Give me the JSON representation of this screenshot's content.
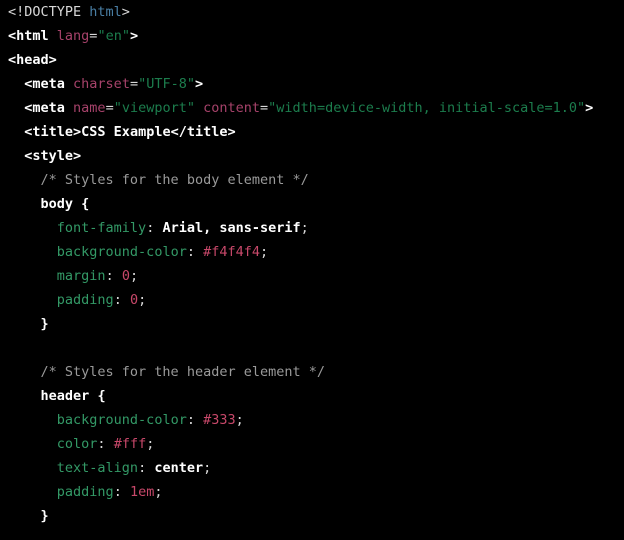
{
  "editor": {
    "background_color": "#000000",
    "language": "html",
    "font_size_px": 13.5,
    "line_height_px": 24,
    "tab_size": 2
  },
  "theme": {
    "punctuation": "#d8d8d8",
    "doctype": "#d8d8d8",
    "doctype_name": "#4a7fa5",
    "tag": "#ffffff",
    "attribute": "#a6426a",
    "string": "#1c7d4d",
    "text": "#ffffff",
    "comment": "#9a9a9a",
    "selector": "#ffffff",
    "property": "#339966",
    "value": "#ffffff",
    "number": "#c8486a"
  },
  "lines": [
    {
      "n": 1,
      "indent": "",
      "tokens": [
        {
          "t": "<!DOCTYPE ",
          "c": "t-doctype"
        },
        {
          "t": "html",
          "c": "t-doctype-name"
        },
        {
          "t": ">",
          "c": "t-punct"
        }
      ]
    },
    {
      "n": 2,
      "indent": "",
      "tokens": [
        {
          "t": "<html",
          "c": "t-tag"
        },
        {
          "t": " ",
          "c": "t-punct"
        },
        {
          "t": "lang",
          "c": "t-attr"
        },
        {
          "t": "=",
          "c": "t-punct"
        },
        {
          "t": "\"en\"",
          "c": "t-string"
        },
        {
          "t": ">",
          "c": "t-tag"
        }
      ]
    },
    {
      "n": 3,
      "indent": "",
      "tokens": [
        {
          "t": "<head>",
          "c": "t-tag"
        }
      ]
    },
    {
      "n": 4,
      "indent": "  ",
      "tokens": [
        {
          "t": "<meta",
          "c": "t-tag"
        },
        {
          "t": " ",
          "c": "t-punct"
        },
        {
          "t": "charset",
          "c": "t-attr"
        },
        {
          "t": "=",
          "c": "t-punct"
        },
        {
          "t": "\"UTF-8\"",
          "c": "t-string"
        },
        {
          "t": ">",
          "c": "t-tag"
        }
      ]
    },
    {
      "n": 5,
      "indent": "  ",
      "tokens": [
        {
          "t": "<meta",
          "c": "t-tag"
        },
        {
          "t": " ",
          "c": "t-punct"
        },
        {
          "t": "name",
          "c": "t-attr"
        },
        {
          "t": "=",
          "c": "t-punct"
        },
        {
          "t": "\"viewport\"",
          "c": "t-string"
        },
        {
          "t": " ",
          "c": "t-punct"
        },
        {
          "t": "content",
          "c": "t-attr"
        },
        {
          "t": "=",
          "c": "t-punct"
        },
        {
          "t": "\"width=device-width, initial-scale=1.0\"",
          "c": "t-string"
        },
        {
          "t": ">",
          "c": "t-tag"
        }
      ]
    },
    {
      "n": 6,
      "indent": "  ",
      "tokens": [
        {
          "t": "<title>",
          "c": "t-tag"
        },
        {
          "t": "CSS Example",
          "c": "t-text"
        },
        {
          "t": "</title>",
          "c": "t-tag"
        }
      ]
    },
    {
      "n": 7,
      "indent": "  ",
      "tokens": [
        {
          "t": "<style>",
          "c": "t-tag"
        }
      ]
    },
    {
      "n": 8,
      "indent": "    ",
      "tokens": [
        {
          "t": "/* Styles for the body element */",
          "c": "t-comment"
        }
      ]
    },
    {
      "n": 9,
      "indent": "    ",
      "tokens": [
        {
          "t": "body",
          "c": "t-selector"
        },
        {
          "t": " ",
          "c": "t-punct"
        },
        {
          "t": "{",
          "c": "t-brace"
        }
      ]
    },
    {
      "n": 10,
      "indent": "      ",
      "tokens": [
        {
          "t": "font-family",
          "c": "t-prop"
        },
        {
          "t": ": ",
          "c": "t-colon"
        },
        {
          "t": "Arial, sans-serif",
          "c": "t-value"
        },
        {
          "t": ";",
          "c": "t-semi"
        }
      ]
    },
    {
      "n": 11,
      "indent": "      ",
      "tokens": [
        {
          "t": "background-color",
          "c": "t-prop"
        },
        {
          "t": ": ",
          "c": "t-colon"
        },
        {
          "t": "#f4f4f4",
          "c": "t-number"
        },
        {
          "t": ";",
          "c": "t-semi"
        }
      ]
    },
    {
      "n": 12,
      "indent": "      ",
      "tokens": [
        {
          "t": "margin",
          "c": "t-prop"
        },
        {
          "t": ": ",
          "c": "t-colon"
        },
        {
          "t": "0",
          "c": "t-number"
        },
        {
          "t": ";",
          "c": "t-semi"
        }
      ]
    },
    {
      "n": 13,
      "indent": "      ",
      "tokens": [
        {
          "t": "padding",
          "c": "t-prop"
        },
        {
          "t": ": ",
          "c": "t-colon"
        },
        {
          "t": "0",
          "c": "t-number"
        },
        {
          "t": ";",
          "c": "t-semi"
        }
      ]
    },
    {
      "n": 14,
      "indent": "    ",
      "tokens": [
        {
          "t": "}",
          "c": "t-brace"
        }
      ]
    },
    {
      "n": 15,
      "indent": "",
      "tokens": []
    },
    {
      "n": 16,
      "indent": "    ",
      "tokens": [
        {
          "t": "/* Styles for the header element */",
          "c": "t-comment"
        }
      ]
    },
    {
      "n": 17,
      "indent": "    ",
      "tokens": [
        {
          "t": "header",
          "c": "t-selector"
        },
        {
          "t": " ",
          "c": "t-punct"
        },
        {
          "t": "{",
          "c": "t-brace"
        }
      ]
    },
    {
      "n": 18,
      "indent": "      ",
      "tokens": [
        {
          "t": "background-color",
          "c": "t-prop"
        },
        {
          "t": ": ",
          "c": "t-colon"
        },
        {
          "t": "#333",
          "c": "t-number"
        },
        {
          "t": ";",
          "c": "t-semi"
        }
      ]
    },
    {
      "n": 19,
      "indent": "      ",
      "tokens": [
        {
          "t": "color",
          "c": "t-prop"
        },
        {
          "t": ": ",
          "c": "t-colon"
        },
        {
          "t": "#fff",
          "c": "t-number"
        },
        {
          "t": ";",
          "c": "t-semi"
        }
      ]
    },
    {
      "n": 20,
      "indent": "      ",
      "tokens": [
        {
          "t": "text-align",
          "c": "t-prop"
        },
        {
          "t": ": ",
          "c": "t-colon"
        },
        {
          "t": "center",
          "c": "t-value"
        },
        {
          "t": ";",
          "c": "t-semi"
        }
      ]
    },
    {
      "n": 21,
      "indent": "      ",
      "tokens": [
        {
          "t": "padding",
          "c": "t-prop"
        },
        {
          "t": ": ",
          "c": "t-colon"
        },
        {
          "t": "1em",
          "c": "t-number"
        },
        {
          "t": ";",
          "c": "t-semi"
        }
      ]
    },
    {
      "n": 22,
      "indent": "    ",
      "tokens": [
        {
          "t": "}",
          "c": "t-brace"
        }
      ]
    }
  ]
}
